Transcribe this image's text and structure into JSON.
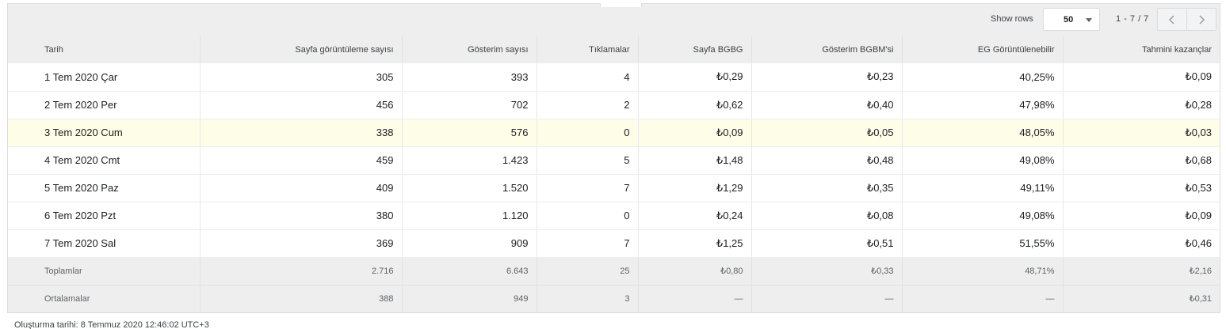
{
  "toolbar": {
    "show_rows_label": "Show rows",
    "rows_value": "50",
    "range": "1 - 7 / 7"
  },
  "colors": {
    "highlight_row": "#fdfde8",
    "panel_bg": "#eeeeee",
    "border": "#dadce0"
  },
  "icons": {
    "prev": "chevron-left-icon",
    "next": "chevron-right-icon",
    "select": "caret-down-icon"
  },
  "table": {
    "columns": [
      "Tarih",
      "Sayfa görüntüleme sayısı",
      "Gösterim sayısı",
      "Tıklamalar",
      "Sayfa BGBG",
      "Gösterim BGBM'si",
      "EG Görüntülenebilir",
      "Tahmini kazançlar"
    ],
    "rows": [
      [
        "1 Tem 2020 Çar",
        "305",
        "393",
        "4",
        "₺0,29",
        "₺0,23",
        "40,25%",
        "₺0,09"
      ],
      [
        "2 Tem 2020 Per",
        "456",
        "702",
        "2",
        "₺0,62",
        "₺0,40",
        "47,98%",
        "₺0,28"
      ],
      [
        "3 Tem 2020 Cum",
        "338",
        "576",
        "0",
        "₺0,09",
        "₺0,05",
        "48,05%",
        "₺0,03"
      ],
      [
        "4 Tem 2020 Cmt",
        "459",
        "1.423",
        "5",
        "₺1,48",
        "₺0,48",
        "49,08%",
        "₺0,68"
      ],
      [
        "5 Tem 2020 Paz",
        "409",
        "1.520",
        "7",
        "₺1,29",
        "₺0,35",
        "49,11%",
        "₺0,53"
      ],
      [
        "6 Tem 2020 Pzt",
        "380",
        "1.120",
        "0",
        "₺0,24",
        "₺0,08",
        "49,08%",
        "₺0,09"
      ],
      [
        "7 Tem 2020 Sal",
        "369",
        "909",
        "7",
        "₺1,25",
        "₺0,51",
        "51,55%",
        "₺0,46"
      ]
    ],
    "totals": [
      "Toplamlar",
      "2.716",
      "6.643",
      "25",
      "₺0,80",
      "₺0,33",
      "48,71%",
      "₺2,16"
    ],
    "averages": [
      "Ortalamalar",
      "388",
      "949",
      "3",
      "—",
      "—",
      "—",
      "₺0,31"
    ]
  },
  "footer": {
    "created": "Oluşturma tarihi: 8 Temmuz 2020 12:46:02 UTC+3"
  }
}
